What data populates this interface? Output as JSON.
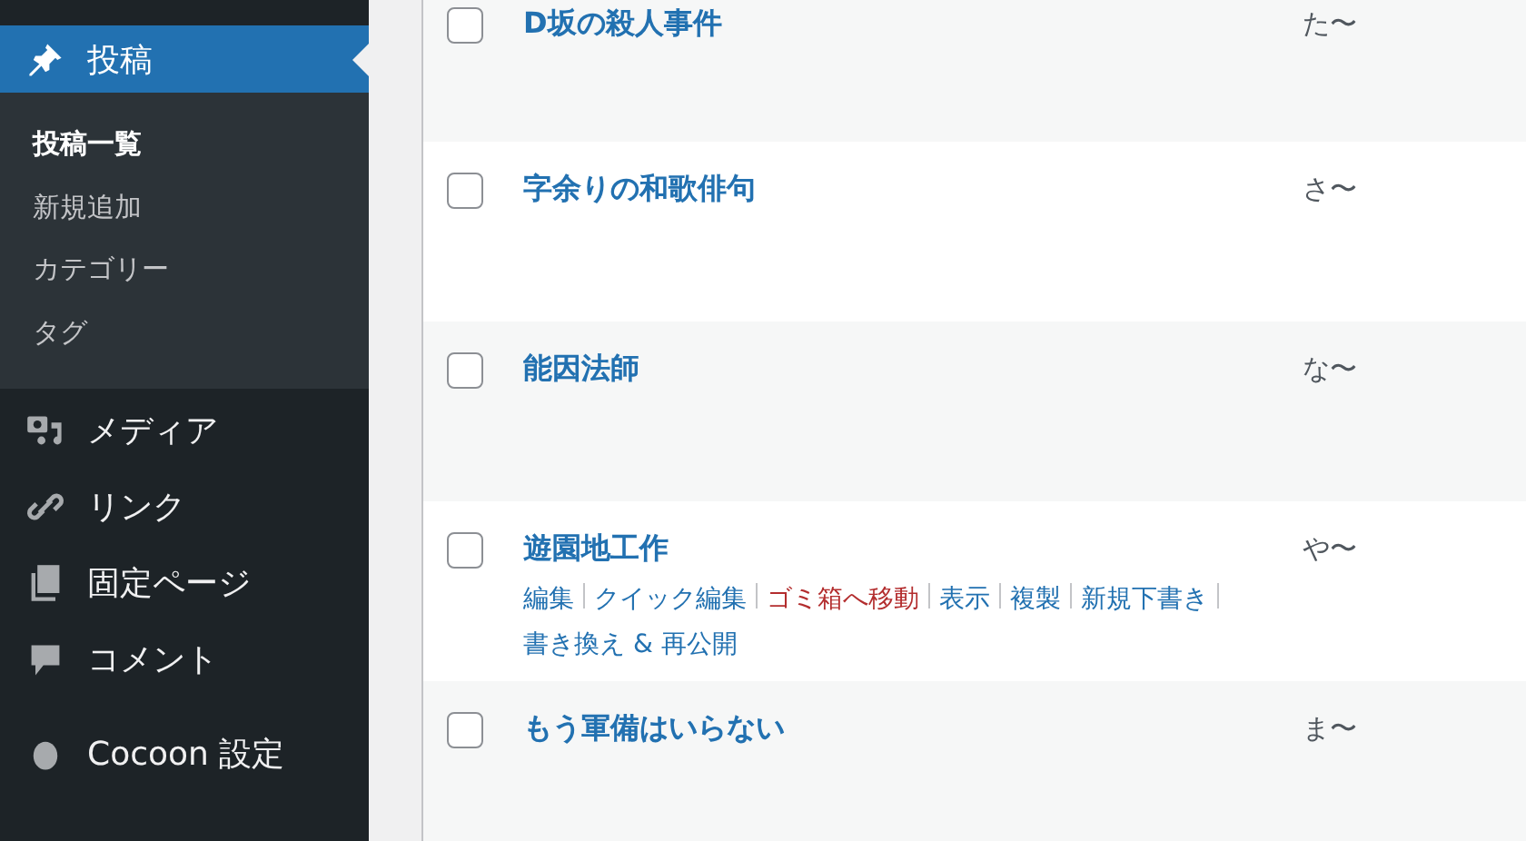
{
  "sidebar": {
    "items": [
      {
        "label": "投稿",
        "kind": "pin",
        "selected": true,
        "children": [
          {
            "label": "投稿一覧",
            "selected": true
          },
          {
            "label": "新規追加",
            "selected": false
          },
          {
            "label": "カテゴリー",
            "selected": false
          },
          {
            "label": "タグ",
            "selected": false
          }
        ]
      },
      {
        "label": "メディア",
        "kind": "media",
        "selected": false
      },
      {
        "label": "リンク",
        "kind": "link",
        "selected": false
      },
      {
        "label": "固定ページ",
        "kind": "pages",
        "selected": false
      },
      {
        "label": "コメント",
        "kind": "comment",
        "selected": false
      },
      {
        "label": "Cocoon 設定",
        "kind": "circle",
        "selected": false
      }
    ]
  },
  "table": {
    "rows": [
      {
        "title": "D坂の殺人事件",
        "column_2": "た〜",
        "checked": false
      },
      {
        "title": "字余りの和歌俳句",
        "column_2": "さ〜",
        "checked": false
      },
      {
        "title": "能因法師",
        "column_2": "な〜",
        "checked": false
      },
      {
        "title": "遊園地工作",
        "column_2": "や〜",
        "checked": false,
        "actions": [
          {
            "label": "編集",
            "kind": "link"
          },
          {
            "label": "クイック編集",
            "kind": "link"
          },
          {
            "label": "ゴミ箱へ移動",
            "kind": "delete"
          },
          {
            "label": "表示",
            "kind": "link"
          },
          {
            "label": "複製",
            "kind": "link"
          },
          {
            "label": "新規下書き",
            "kind": "link"
          },
          {
            "label": "書き換え & 再公開",
            "kind": "link"
          }
        ]
      },
      {
        "title": "もう軍備はいらない",
        "column_2": "ま〜",
        "checked": false
      }
    ]
  }
}
